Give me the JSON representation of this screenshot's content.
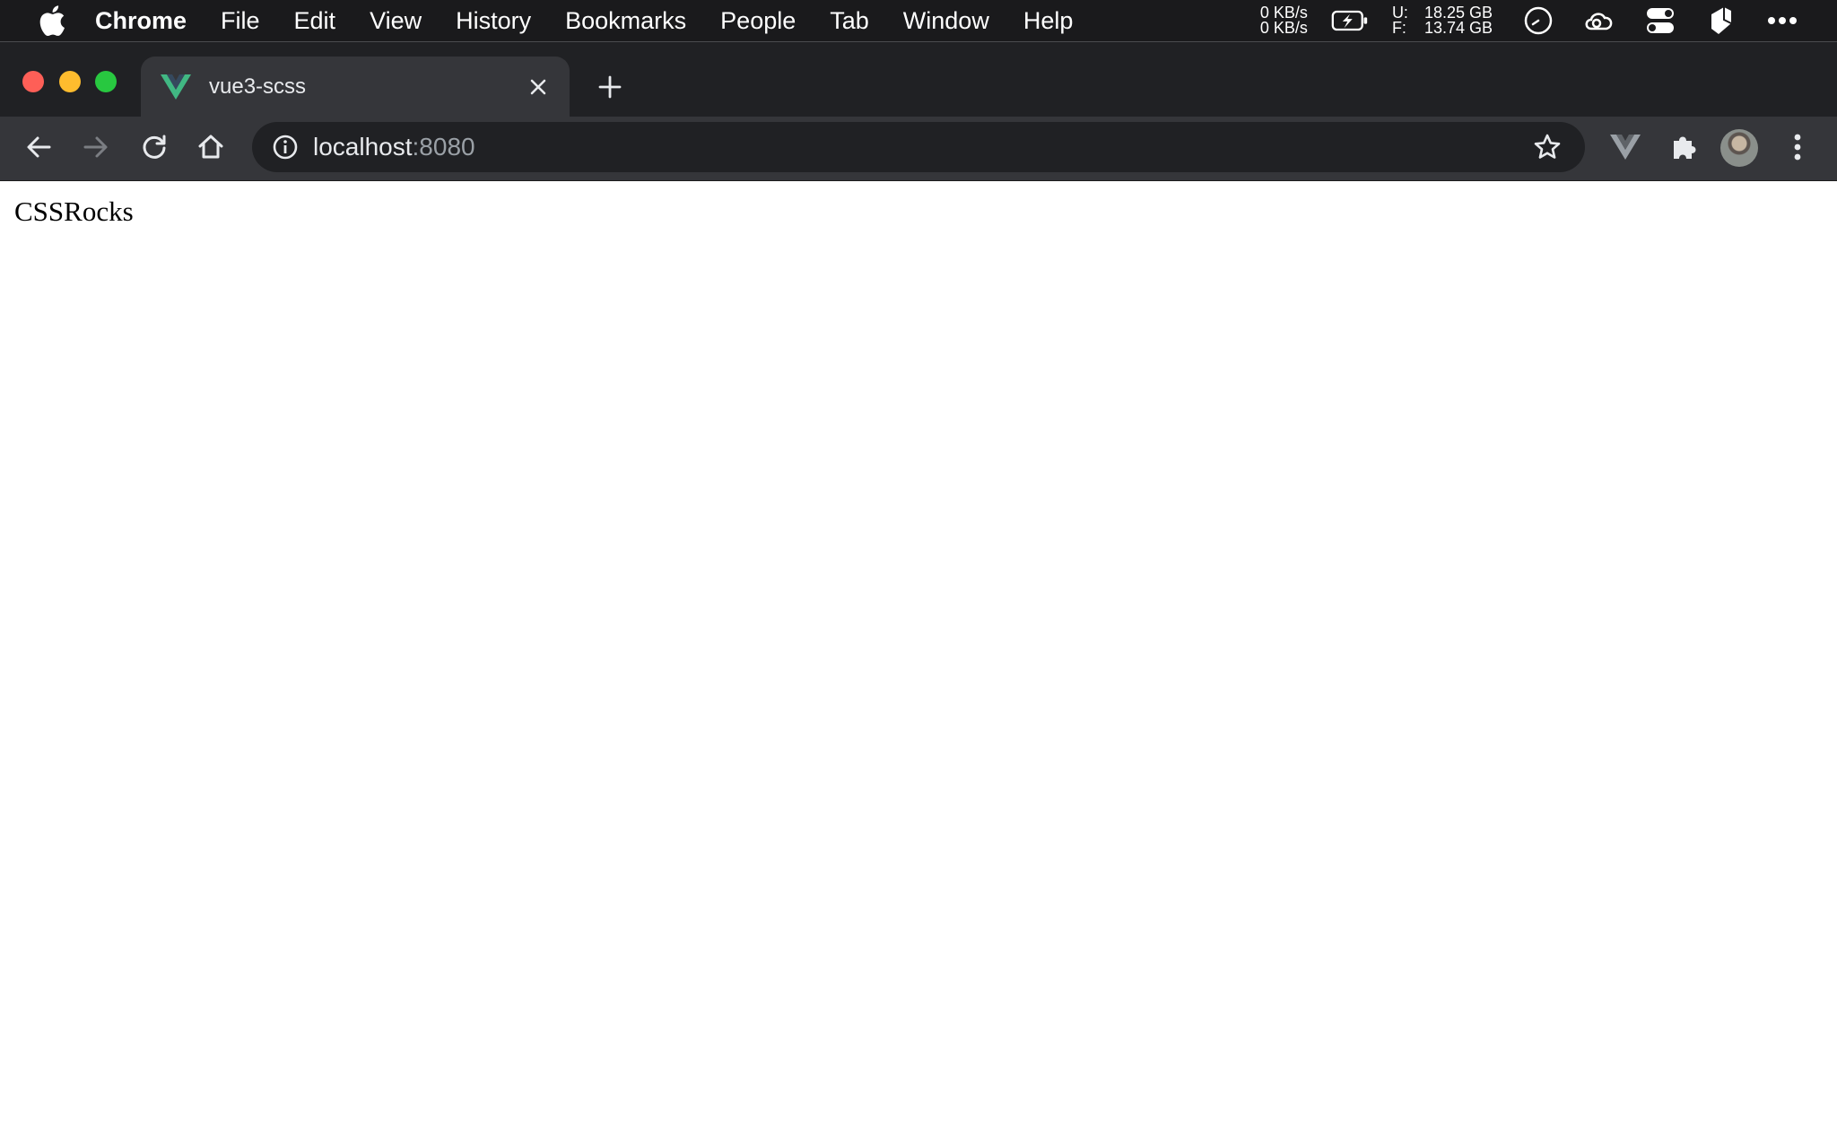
{
  "menubar": {
    "apple_icon": "apple-icon",
    "items": [
      "Chrome",
      "File",
      "Edit",
      "View",
      "History",
      "Bookmarks",
      "People",
      "Tab",
      "Window",
      "Help"
    ],
    "network": {
      "up": "0 KB/s",
      "down": "0 KB/s"
    },
    "disk": {
      "used_label": "U:",
      "used_value": "18.25 GB",
      "free_label": "F:",
      "free_value": "13.74 GB"
    },
    "status_icons": [
      "battery-charging-icon",
      "clock-icon",
      "creative-cloud-icon",
      "control-center-icon",
      "sketch-icon",
      "more-icon"
    ]
  },
  "browser": {
    "tab": {
      "title": "vue3-scss",
      "favicon": "vue-logo-icon",
      "favicon_color": "#41b883"
    },
    "omnibox": {
      "host": "localhost",
      "port": ":8080"
    },
    "toolbar_icons": [
      "back-icon",
      "forward-icon",
      "reload-icon",
      "home-icon",
      "info-icon",
      "star-icon",
      "vue-devtools-icon",
      "extensions-icon",
      "avatar",
      "kebab-menu-icon"
    ]
  },
  "page": {
    "text": "CSSRocks"
  },
  "colors": {
    "menubar_bg": "#1a1a1c",
    "tabstrip_bg": "#202124",
    "toolbar_bg": "#35363a",
    "traffic_red": "#fe5f57",
    "traffic_yellow": "#febc2e",
    "traffic_green": "#28c840"
  }
}
